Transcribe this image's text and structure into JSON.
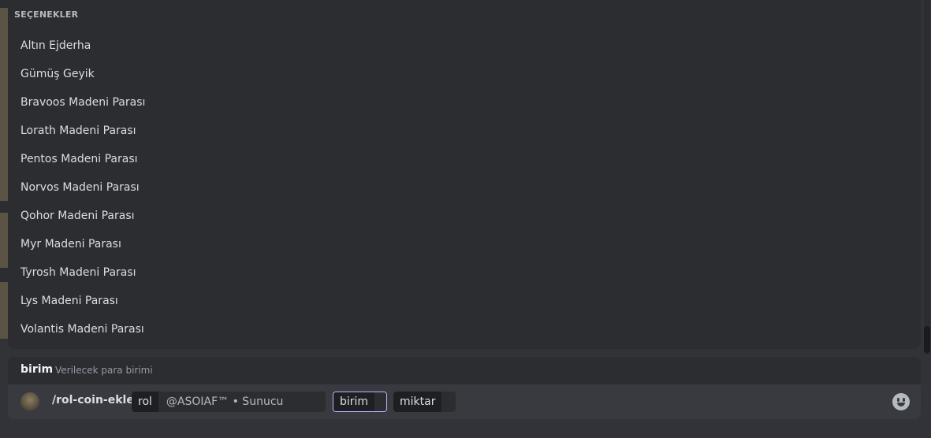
{
  "options": {
    "header": "SEÇENEKLER",
    "items": [
      "Altın Ejderha",
      "Gümüş Geyik",
      "Bravoos Madeni Parası",
      "Lorath Madeni Parası",
      "Pentos Madeni Parası",
      "Norvos Madeni Parası",
      "Qohor Madeni Parası",
      "Myr Madeni Parası",
      "Tyrosh Madeni Parası",
      "Lys Madeni Parası",
      "Volantis Madeni Parası"
    ]
  },
  "hint": {
    "param_name": "birim",
    "description": "Verilecek para birimi"
  },
  "command": {
    "name": "/rol-coin-ekle",
    "params": [
      {
        "label": "rol",
        "value": "@ASOIAF™ • Sunucu Sahibi"
      },
      {
        "label": "birim",
        "value": ""
      },
      {
        "label": "miktar",
        "value": ""
      }
    ],
    "emoji_icon": "smiley-face-icon"
  }
}
